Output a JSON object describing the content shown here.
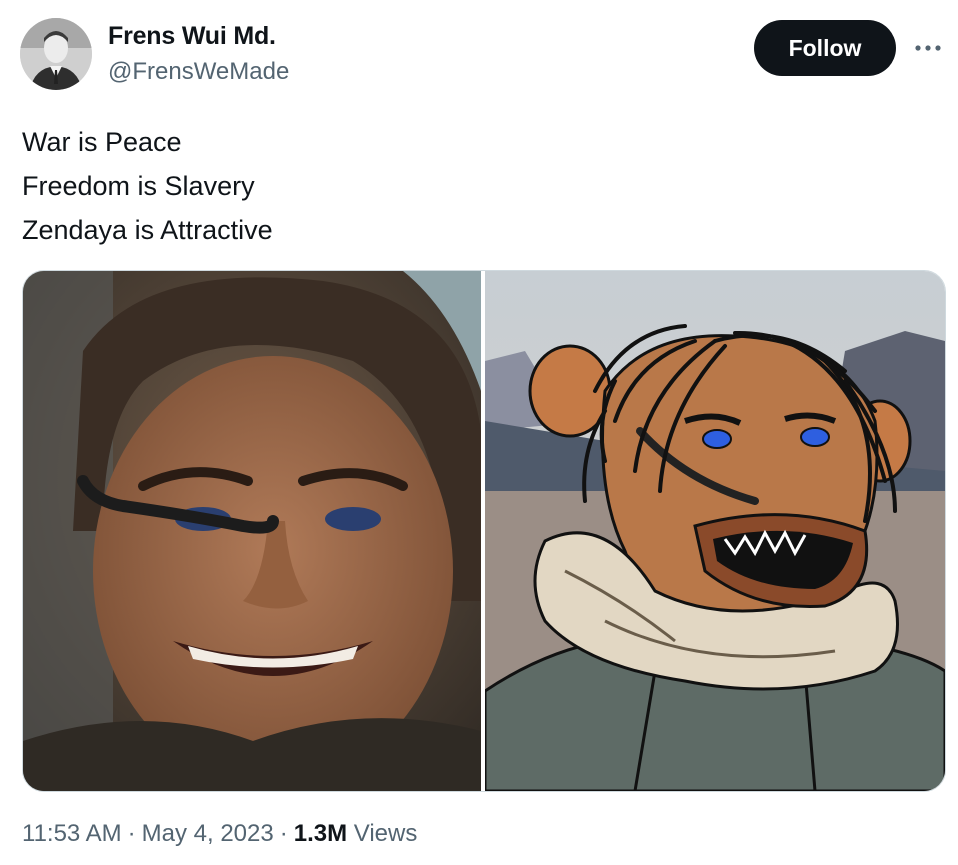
{
  "author": {
    "name": "Frens Wui Md.",
    "handle": "@FrensWeMade"
  },
  "header": {
    "follow_label": "Follow",
    "more_icon": "more-horizontal-icon"
  },
  "tweet": {
    "lines": [
      "War is Peace",
      "Freedom is Slavery",
      "Zendaya is Attractive"
    ]
  },
  "media": {
    "count": 2
  },
  "meta": {
    "time": "11:53 AM",
    "date": "May 4, 2023",
    "separator": "·",
    "views_count": "1.3M",
    "views_label": "Views"
  },
  "colors": {
    "text_primary": "#0f1419",
    "text_secondary": "#536471",
    "follow_bg": "#0f1419",
    "follow_text": "#ffffff",
    "border": "#cfd9de"
  }
}
